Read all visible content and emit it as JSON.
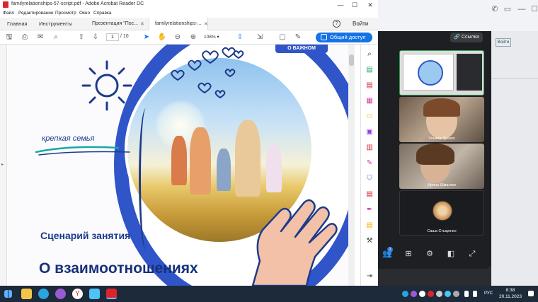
{
  "window": {
    "title": "familyrelationships-57-script.pdf - Adobe Acrobat Reader DC",
    "minimize": "—",
    "maximize": "☐",
    "close": "✕"
  },
  "menu": [
    "Файл",
    "Редактирование",
    "Просмотр",
    "Окно",
    "Справка"
  ],
  "tabs": {
    "home": "Главная",
    "tools": "Инструменты",
    "doc1": "Презентация \"Пос...",
    "doc2": "familyrelationships-...",
    "help": "?",
    "login": "Войти"
  },
  "toolbar": {
    "page_current": "1",
    "page_total": "/ 10",
    "zoom": "108%",
    "share": "Общий доступ"
  },
  "page": {
    "badge": "О ВАЖНОМ",
    "tagline": "крепкая семья",
    "subtitle": "Сценарий занятия",
    "title": "О взаимоотношениях"
  },
  "call": {
    "link_button": "Ссылка",
    "participants": [
      {
        "name": "Ульяна Зуенко"
      },
      {
        "name": "Ирина Шмаглко"
      },
      {
        "name": "Саша Стыценко"
      }
    ],
    "participants_badge": "3"
  },
  "taskbar": {
    "lang": "РУС",
    "time": "8:38",
    "date": "20.11.2023"
  },
  "colors": {
    "accent": "#1473e6",
    "brand_blue": "#1d3b8a",
    "active_tile": "#2fa84f"
  }
}
